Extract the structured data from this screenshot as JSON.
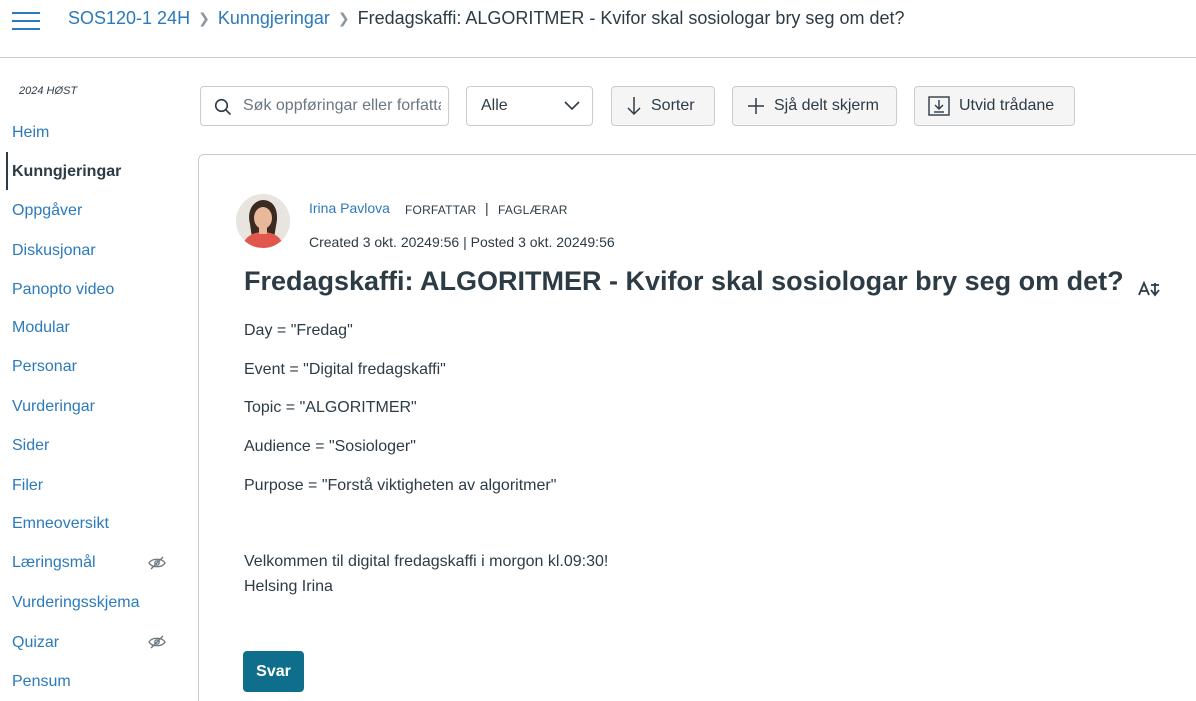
{
  "breadcrumb": {
    "course": "SOS120-1 24H",
    "section": "Kunngjeringar",
    "current": "Fredagskaffi: ALGORITMER - Kvifor skal sosiologar bry seg om det?"
  },
  "sidebar": {
    "term": "2024 HØST",
    "items": [
      {
        "label": "Heim"
      },
      {
        "label": "Kunngjeringar",
        "active": true
      },
      {
        "label": "Oppgåver"
      },
      {
        "label": "Diskusjonar"
      },
      {
        "label": "Panopto video"
      },
      {
        "label": "Modular"
      },
      {
        "label": "Personar"
      },
      {
        "label": "Vurderingar"
      },
      {
        "label": "Sider"
      },
      {
        "label": "Filer"
      },
      {
        "label": "Emneoversikt"
      },
      {
        "label": "Læringsmål",
        "hidden_icon": "eye-slash-icon"
      },
      {
        "label": "Vurderingsskjema"
      },
      {
        "label": "Quizar",
        "hidden_icon": "eye-slash-icon"
      },
      {
        "label": "Pensum"
      }
    ]
  },
  "toolbar": {
    "search_placeholder": "Søk oppføringar eller forfattar",
    "filter_value": "Alle",
    "sort_label": "Sorter",
    "split_label": "Sjå delt skjerm",
    "expand_label": "Utvid trådane"
  },
  "post": {
    "author": "Irina Pavlova",
    "role_1": "FORFATTAR",
    "role_separator": "|",
    "role_2": "FAGLÆRAR",
    "dates": "Created 3 okt. 20249:56 | Posted 3 okt. 20249:56",
    "title": "Fredagskaffi: ALGORITMER - Kvifor skal sosiologar bry seg om det?",
    "lines": [
      "Day = \"Fredag\"",
      "Event = \"Digital fredagskaffi\"",
      "Topic = \"ALGORITMER\"",
      "Audience = \"Sosiologer\"",
      "Purpose = \"Forstå viktigheten av algoritmer\""
    ],
    "greeting": "Velkommen til digital fredagskaffi i morgon kl.09:30!",
    "signoff": "Helsing Irina",
    "reply_label": "Svar"
  },
  "colors": {
    "link": "#2b7abc",
    "text": "#2d3b45",
    "reply_button": "#0e6e8c",
    "border": "#c7cdd1"
  }
}
